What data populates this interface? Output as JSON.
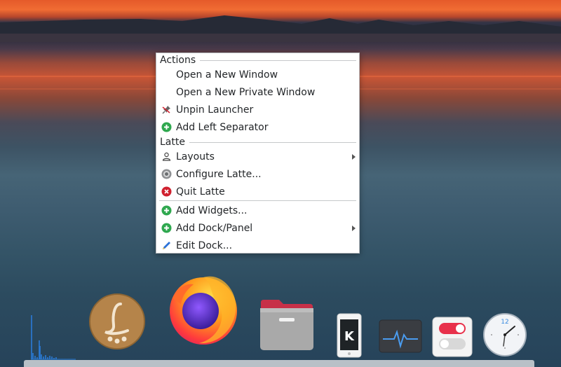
{
  "menu": {
    "sections": [
      {
        "title": "Actions"
      },
      {
        "title": "Latte"
      }
    ],
    "items": [
      {
        "label": "Open a New Window",
        "icon": "none"
      },
      {
        "label": "Open a New Private Window",
        "icon": "none"
      },
      {
        "label": "Unpin Launcher",
        "icon": "unpin-icon"
      },
      {
        "label": "Add Left Separator",
        "icon": "add-icon"
      },
      {
        "label": "Layouts",
        "icon": "user-icon",
        "submenu": true
      },
      {
        "label": "Configure Latte...",
        "icon": "configure-icon"
      },
      {
        "label": "Quit Latte",
        "icon": "quit-icon"
      },
      {
        "label": "Add Widgets...",
        "icon": "add-icon"
      },
      {
        "label": "Add Dock/Panel",
        "icon": "add-icon",
        "submenu": true
      },
      {
        "label": "Edit Dock...",
        "icon": "edit-icon"
      }
    ]
  },
  "dock": {
    "apps": [
      {
        "name": "cpu-graph-widget"
      },
      {
        "name": "latte-dock-app"
      },
      {
        "name": "firefox-app"
      },
      {
        "name": "file-manager-app"
      },
      {
        "name": "kde-connect-app"
      },
      {
        "name": "system-monitor-app"
      },
      {
        "name": "settings-toggle-app"
      },
      {
        "name": "clock-app",
        "clock_number": "12"
      }
    ]
  },
  "colors": {
    "add": "#2fa84f",
    "quit": "#d0212f",
    "edit": "#2d73d8",
    "firefox_orange": "#ff7b1c",
    "latte_brown": "#b5844a"
  }
}
